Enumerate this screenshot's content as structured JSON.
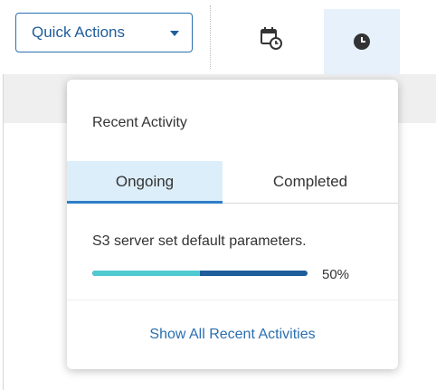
{
  "toolbar": {
    "quick_actions_label": "Quick Actions",
    "calendar_icon": "calendar-clock-icon",
    "clock_icon": "clock-icon"
  },
  "recent_activity": {
    "title": "Recent Activity",
    "tabs": [
      {
        "label": "Ongoing",
        "active": true
      },
      {
        "label": "Completed",
        "active": false
      }
    ],
    "items": [
      {
        "text": "S3 server set default parameters.",
        "progress": 0.5,
        "percent_label": "50%"
      }
    ],
    "show_all_label": "Show All Recent Activities"
  },
  "colors": {
    "accent": "#2a6fb0",
    "progress_done": "#4fcad0",
    "progress_track": "#1f5d9b",
    "active_tab_bg": "#dceefa"
  }
}
